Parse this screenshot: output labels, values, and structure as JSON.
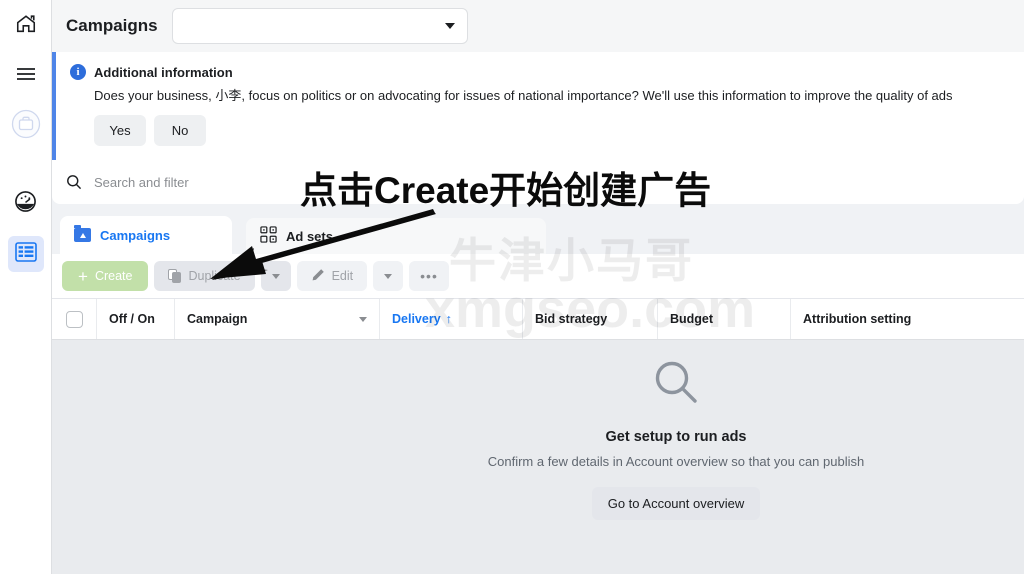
{
  "sidebar": {
    "items": [
      {
        "name": "home",
        "icon": "home-icon",
        "active": false
      },
      {
        "name": "menu",
        "icon": "hamburger-menu-icon",
        "active": false
      },
      {
        "name": "business",
        "icon": "business-avatar-icon",
        "active": false
      },
      {
        "name": "performance",
        "icon": "gauge-icon",
        "active": false
      },
      {
        "name": "ads-manager",
        "icon": "table-grid-icon",
        "active": true
      }
    ]
  },
  "topbar": {
    "title": "Campaigns",
    "account_select_value": "",
    "account_select_placeholder": ""
  },
  "banner": {
    "icon": "info-icon",
    "badge": "i",
    "title": "Additional information",
    "body": "Does your business, 小李, focus on politics or on advocating for issues of national importance? We'll use this information to improve the quality of ads",
    "buttons": [
      {
        "label": "Yes"
      },
      {
        "label": "No"
      }
    ]
  },
  "search": {
    "icon": "search-icon",
    "placeholder": "Search and filter"
  },
  "tabs": [
    {
      "label": "Campaigns",
      "icon": "campaign-folder-icon",
      "active": true
    },
    {
      "label": "Ad sets",
      "icon": "adsets-grid-icon",
      "active": false
    }
  ],
  "toolbar": {
    "create_label": "Create",
    "duplicate_label": "Duplicate",
    "edit_label": "Edit",
    "more_label": "•••"
  },
  "table": {
    "columns": [
      {
        "key": "checkbox",
        "label": ""
      },
      {
        "key": "offon",
        "label": "Off / On"
      },
      {
        "key": "campaign",
        "label": "Campaign"
      },
      {
        "key": "delivery",
        "label": "Delivery",
        "sort": "↑",
        "sorted": true
      },
      {
        "key": "bid",
        "label": "Bid strategy"
      },
      {
        "key": "budget",
        "label": "Budget"
      },
      {
        "key": "attribution",
        "label": "Attribution setting"
      }
    ],
    "rows": []
  },
  "empty_state": {
    "icon": "magnifier-icon",
    "title": "Get setup to run ads",
    "subtitle": "Confirm a few details in Account overview so that you can publish",
    "button_label": "Go to Account overview"
  },
  "annotation": {
    "text": "点击Create开始创建广告",
    "arrow": "arrow-pointing-to-create-button"
  },
  "watermark": {
    "cn": "牛津小马哥",
    "en": "xmgseo.com"
  },
  "colors": {
    "accent_blue": "#1877f2",
    "create_green": "#c2e0a9",
    "banner_border": "#4f85e8",
    "page_bg": "#f0f2f5",
    "empty_bg": "#e9ebee"
  }
}
